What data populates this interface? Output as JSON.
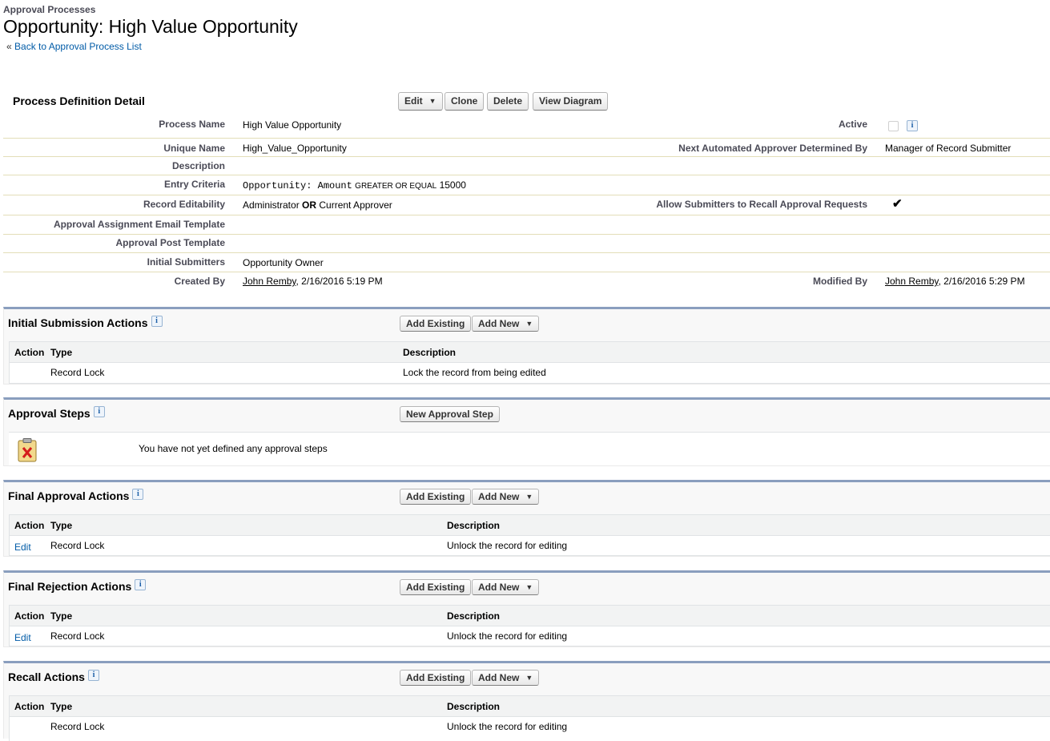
{
  "header": {
    "eyebrow": "Approval Processes",
    "title": "Opportunity: High Value Opportunity",
    "back_prefix": "«",
    "back_link": "Back to Approval Process List"
  },
  "detail": {
    "title": "Process Definition Detail",
    "buttons": {
      "edit": "Edit",
      "clone": "Clone",
      "delete": "Delete",
      "view_diagram": "View Diagram"
    },
    "process_name_label": "Process Name",
    "process_name": "High Value Opportunity",
    "active_label": "Active",
    "unique_name_label": "Unique Name",
    "unique_name": "High_Value_Opportunity",
    "next_approver_label": "Next Automated Approver Determined By",
    "next_approver": "Manager of Record Submitter",
    "description_label": "Description",
    "entry_criteria_label": "Entry Criteria",
    "entry_field": "Opportunity: Amount",
    "entry_operator": "GREATER OR EQUAL",
    "entry_value": "15000",
    "record_editability_label": "Record Editability",
    "editability_part1": "Administrator",
    "editability_or": "OR",
    "editability_part2": "Current Approver",
    "allow_recall_label": "Allow Submitters to Recall Approval Requests",
    "email_template_label": "Approval Assignment Email Template",
    "post_template_label": "Approval Post Template",
    "initial_submitters_label": "Initial Submitters",
    "initial_submitters": "Opportunity Owner",
    "created_by_label": "Created By",
    "created_by_user": "John Remby",
    "created_by_date": ", 2/16/2016 5:19 PM",
    "modified_by_label": "Modified By",
    "modified_by_user": "John Remby",
    "modified_by_date": ", 2/16/2016 5:29 PM"
  },
  "common": {
    "add_existing": "Add Existing",
    "add_new": "Add New",
    "col_action": "Action",
    "col_type": "Type",
    "col_description": "Description",
    "info": "i"
  },
  "initial_submission": {
    "title": "Initial Submission Actions",
    "row": {
      "action": "",
      "type": "Record Lock",
      "description": "Lock the record from being edited"
    }
  },
  "approval_steps": {
    "title": "Approval Steps",
    "button": "New Approval Step",
    "empty_text": "You have not yet defined any approval steps"
  },
  "final_approval": {
    "title": "Final Approval Actions",
    "row": {
      "action": "Edit",
      "type": "Record Lock",
      "description": "Unlock the record for editing"
    }
  },
  "final_rejection": {
    "title": "Final Rejection Actions",
    "row": {
      "action": "Edit",
      "type": "Record Lock",
      "description": "Unlock the record for editing"
    }
  },
  "recall": {
    "title": "Recall Actions",
    "row": {
      "action": "",
      "type": "Record Lock",
      "description": "Unlock the record for editing"
    }
  }
}
